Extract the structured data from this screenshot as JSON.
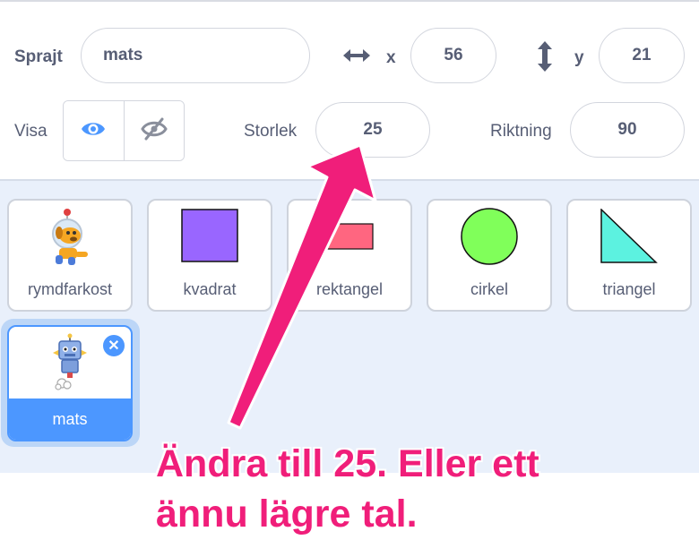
{
  "sprite_info": {
    "sprite_label": "Sprajt",
    "sprite_name": "mats",
    "x_label": "x",
    "x_value": "56",
    "y_label": "y",
    "y_value": "21",
    "show_label": "Visa",
    "size_label": "Storlek",
    "size_value": "25",
    "direction_label": "Riktning",
    "direction_value": "90",
    "visible": true
  },
  "sprites": [
    {
      "name": "rymdfarkost",
      "icon": "astronaut-dog-icon"
    },
    {
      "name": "kvadrat",
      "icon": "square-icon",
      "color": "#9966ff"
    },
    {
      "name": "rektangel",
      "icon": "rectangle-icon",
      "color": "#ff6680"
    },
    {
      "name": "cirkel",
      "icon": "circle-icon",
      "color": "#80ff5a"
    },
    {
      "name": "triangel",
      "icon": "triangle-icon",
      "color": "#5cf2e0"
    },
    {
      "name": "mats",
      "icon": "robot-icon",
      "selected": true
    }
  ],
  "annotation": {
    "line1": "Ändra till 25. Eller ett",
    "line2": "ännu lägre tal.",
    "color": "#f01e7a"
  },
  "colors": {
    "accent": "#4c97ff",
    "text": "#575e75"
  }
}
